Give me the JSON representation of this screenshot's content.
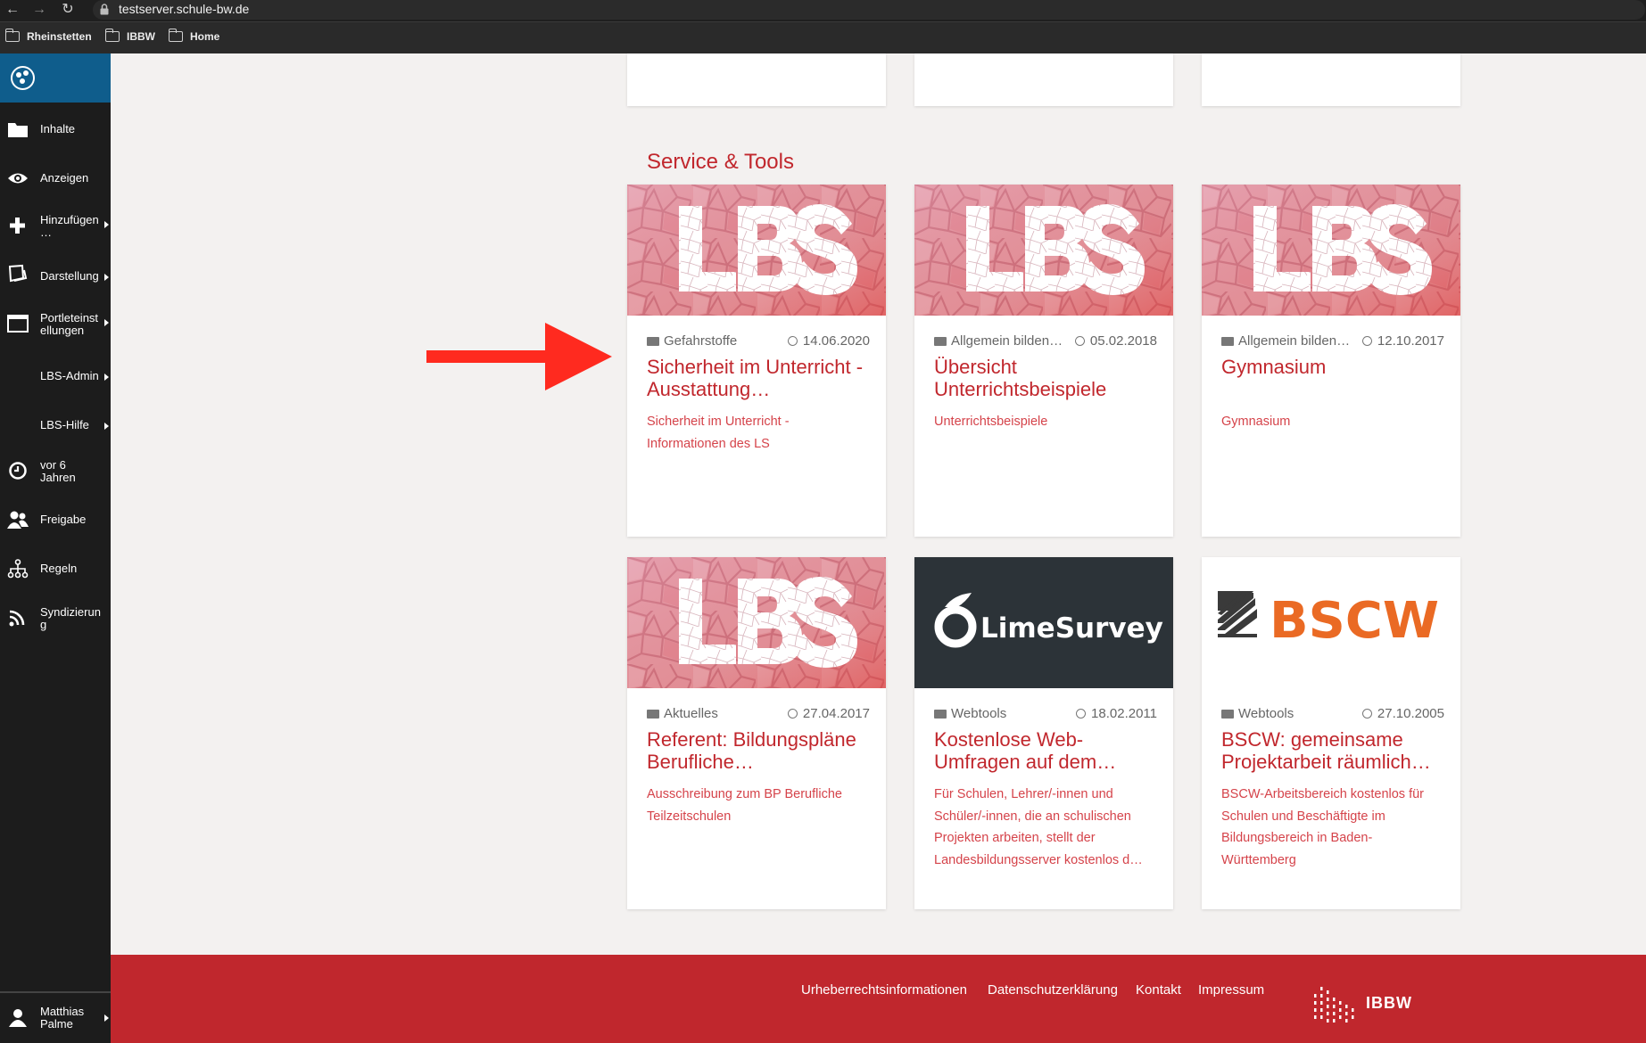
{
  "browser": {
    "url": "testserver.schule-bw.de",
    "bookmarks": [
      "Rheinstetten",
      "IBBW",
      "Home"
    ]
  },
  "toolbar": {
    "items": [
      {
        "label": "Inhalte",
        "icon": "folder-icon",
        "has_submenu": false
      },
      {
        "label": "Anzeigen",
        "icon": "eye-icon",
        "has_submenu": false
      },
      {
        "label": "Hinzufügen …",
        "icon": "plus-icon",
        "has_submenu": true
      },
      {
        "label": "Darstellung",
        "icon": "display-icon",
        "has_submenu": true
      },
      {
        "label": "Portleteinst ellungen",
        "icon": "window-icon",
        "has_submenu": true
      },
      {
        "label": "LBS-Admin",
        "icon": "",
        "has_submenu": true
      },
      {
        "label": "LBS-Hilfe",
        "icon": "",
        "has_submenu": true
      },
      {
        "label": "vor 6 Jahren",
        "icon": "clock-icon",
        "has_submenu": false
      },
      {
        "label": "Freigabe",
        "icon": "users-icon",
        "has_submenu": false
      },
      {
        "label": "Regeln",
        "icon": "sitemap-icon",
        "has_submenu": false
      },
      {
        "label": "Syndizierun g",
        "icon": "rss-icon",
        "has_submenu": false
      }
    ],
    "user": "Matthias Palme"
  },
  "section_title": "Service & Tools",
  "cards": [
    {
      "image": "lbs",
      "category": "Gefahrstoffe",
      "date": "14.06.2020",
      "title": "Sicherheit im Unterricht - Ausstattung…",
      "desc": "Sicherheit im Unterricht - Informationen des LS"
    },
    {
      "image": "lbs",
      "category": "Allgemein bildend…",
      "date": "05.02.2018",
      "title": "Übersicht Unterrichtsbeispiele",
      "desc": "Unterrichtsbeispiele"
    },
    {
      "image": "lbs",
      "category": "Allgemein bildend…",
      "date": "12.10.2017",
      "title": "Gymnasium",
      "desc": "Gymnasium"
    },
    {
      "image": "lbs",
      "category": "Aktuelles",
      "date": "27.04.2017",
      "title": "Referent: Bildungspläne Berufliche…",
      "desc": "Ausschreibung zum BP Berufliche Teilzeitschulen"
    },
    {
      "image": "limesurvey",
      "image_text": "LimeSurvey",
      "category": "Webtools",
      "date": "18.02.2011",
      "title": "Kostenlose Web-Umfragen auf dem…",
      "desc": "Für Schulen, Lehrer/-innen und Schüler/-innen, die an schulischen Projekten arbeiten, stellt der Landesbildungsserver kostenlos d…"
    },
    {
      "image": "bscw",
      "image_text": "BSCW",
      "category": "Webtools",
      "date": "27.10.2005",
      "title": "BSCW: gemeinsame Projektarbeit räumlich…",
      "desc": "BSCW-Arbeitsbereich kostenlos für Schulen und Beschäftigte im Bildungsbereich in Baden-Württemberg"
    }
  ],
  "footer": {
    "links": [
      "Urheberrechtsinformationen",
      "Datenschutzerklärung",
      "Kontakt",
      "Impressum"
    ],
    "logo_text": "IBBW"
  },
  "colors": {
    "accent": "#c1272d",
    "toolbar_bg": "#1c1c1c",
    "toolbar_logo_bg": "#0f5d8c",
    "annotation_arrow": "#ff2a1f"
  }
}
